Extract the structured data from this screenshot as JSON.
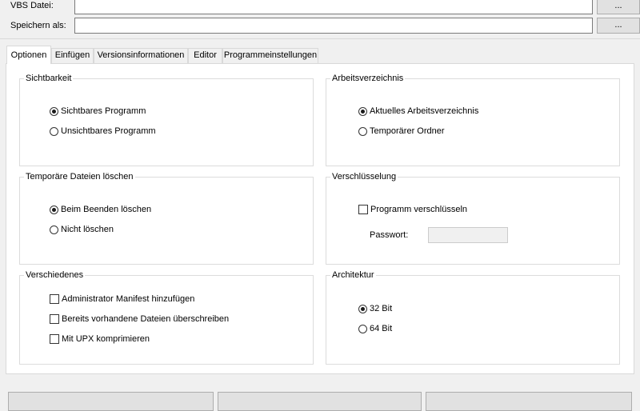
{
  "top": {
    "vbs_label": "VBS Datei:",
    "vbs_value": "",
    "vbs_browse": "...",
    "save_label": "Speichern als:",
    "save_value": "",
    "save_browse": "..."
  },
  "tabs": [
    {
      "label": "Optionen",
      "active": true
    },
    {
      "label": "Einfügen",
      "active": false
    },
    {
      "label": "Versionsinformationen",
      "active": false
    },
    {
      "label": "Editor",
      "active": false
    },
    {
      "label": "Programmeinstellungen",
      "active": false
    }
  ],
  "groups": {
    "visibility": {
      "title": "Sichtbarkeit",
      "options": [
        "Sichtbares Programm",
        "Unsichtbares Programm"
      ],
      "selected": 0
    },
    "workdir": {
      "title": "Arbeitsverzeichnis",
      "options": [
        "Aktuelles Arbeitsverzeichnis",
        "Temporärer Ordner"
      ],
      "selected": 0
    },
    "tempfiles": {
      "title": "Temporäre Dateien löschen",
      "options": [
        "Beim Beenden löschen",
        "Nicht löschen"
      ],
      "selected": 0
    },
    "encryption": {
      "title": "Verschlüsselung",
      "checkbox": "Programm verschlüsseln",
      "checked": false,
      "password_label": "Passwort:",
      "password_value": ""
    },
    "misc": {
      "title": "Verschiedenes",
      "checkboxes": [
        {
          "label": "Administrator Manifest hinzufügen",
          "checked": false
        },
        {
          "label": "Bereits vorhandene Dateien überschreiben",
          "checked": false
        },
        {
          "label": "Mit UPX komprimieren",
          "checked": false
        }
      ]
    },
    "arch": {
      "title": "Architektur",
      "options": [
        "32 Bit",
        "64 Bit"
      ],
      "selected": 0
    }
  }
}
